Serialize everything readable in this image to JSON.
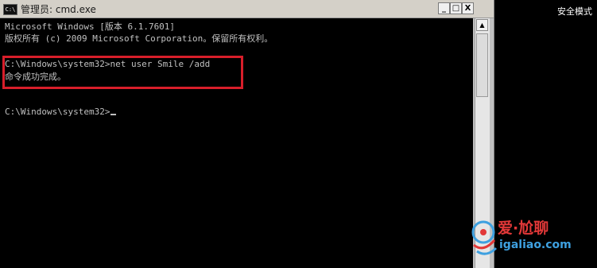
{
  "screen": {
    "safe_mode_label": "安全模式"
  },
  "window": {
    "icon_text": "C:\\",
    "title": "管理员: cmd.exe",
    "buttons": {
      "minimize": "_",
      "maximize": "□",
      "close": "X"
    }
  },
  "console": {
    "lines": [
      "Microsoft Windows [版本 6.1.7601]",
      "版权所有 (c) 2009 Microsoft Corporation。保留所有权利。",
      "",
      "C:\\Windows\\system32>net user Smile /add",
      "命令成功完成。",
      "",
      "",
      "C:\\Windows\\system32>"
    ],
    "highlight_color": "#d81e2a"
  },
  "scrollbar": {
    "up_arrow": "▲"
  },
  "watermark": {
    "brand": "爱·尬聊",
    "url": "igaliao.com",
    "brand_color": "#e23838",
    "url_color": "#3ea0e0"
  }
}
